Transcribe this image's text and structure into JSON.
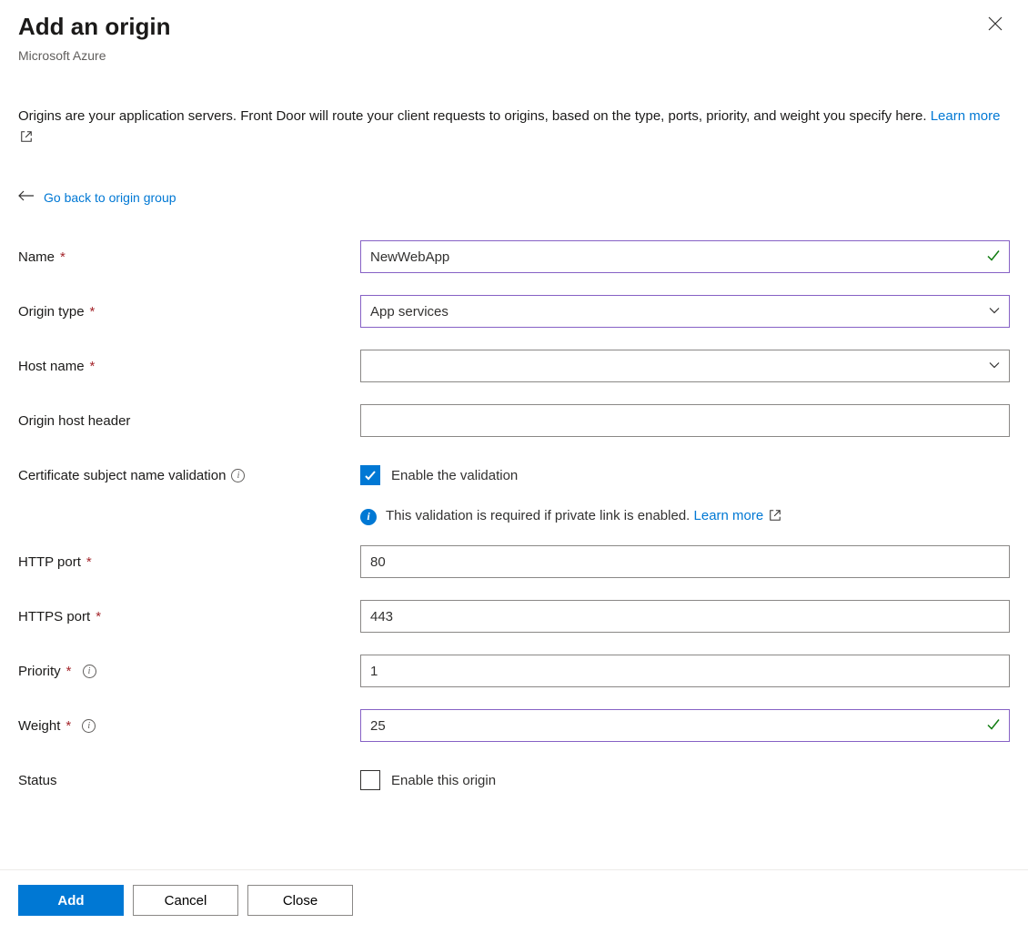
{
  "header": {
    "title": "Add an origin",
    "subtitle": "Microsoft Azure"
  },
  "description": {
    "text_prefix": "Origins are your application servers. Front Door will route your client requests to origins, based on the type, ports, priority, and weight you specify here. ",
    "learn_more": "Learn more"
  },
  "back_link": "Go back to origin group",
  "form": {
    "name": {
      "label": "Name",
      "value": "NewWebApp"
    },
    "origin_type": {
      "label": "Origin type",
      "value": "App services"
    },
    "host_name": {
      "label": "Host name",
      "value": ""
    },
    "host_header": {
      "label": "Origin host header",
      "value": ""
    },
    "cert_validation": {
      "label": "Certificate subject name validation",
      "checkbox_label": "Enable the validation",
      "checked": true,
      "info_text": "This validation is required if private link is enabled. ",
      "info_link": "Learn more"
    },
    "http_port": {
      "label": "HTTP port",
      "value": "80"
    },
    "https_port": {
      "label": "HTTPS port",
      "value": "443"
    },
    "priority": {
      "label": "Priority",
      "value": "1"
    },
    "weight": {
      "label": "Weight",
      "value": "25"
    },
    "status": {
      "label": "Status",
      "checkbox_label": "Enable this origin",
      "checked": false
    }
  },
  "footer": {
    "add": "Add",
    "cancel": "Cancel",
    "close": "Close"
  }
}
